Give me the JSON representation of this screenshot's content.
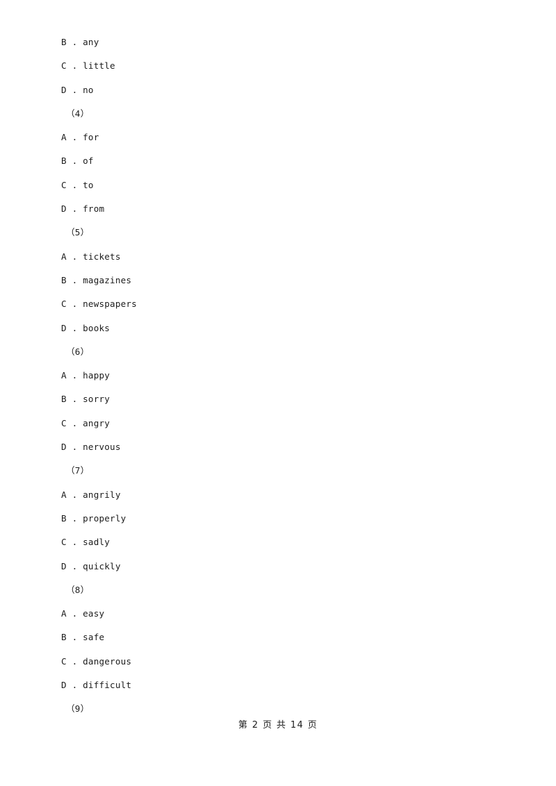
{
  "document": {
    "type": "exam-paper",
    "page_background": "#ffffff",
    "text_color": "#1c1c1c"
  },
  "lines": [
    {
      "kind": "option",
      "text": "B . any"
    },
    {
      "kind": "option",
      "text": "C . little"
    },
    {
      "kind": "option",
      "text": "D . no"
    },
    {
      "kind": "qnum",
      "text": "（4）"
    },
    {
      "kind": "option",
      "text": "A . for"
    },
    {
      "kind": "option",
      "text": "B . of"
    },
    {
      "kind": "option",
      "text": "C . to"
    },
    {
      "kind": "option",
      "text": "D . from"
    },
    {
      "kind": "qnum",
      "text": "（5）"
    },
    {
      "kind": "option",
      "text": "A . tickets"
    },
    {
      "kind": "option",
      "text": "B . magazines"
    },
    {
      "kind": "option",
      "text": "C . newspapers"
    },
    {
      "kind": "option",
      "text": "D . books"
    },
    {
      "kind": "qnum",
      "text": "（6）"
    },
    {
      "kind": "option",
      "text": "A . happy"
    },
    {
      "kind": "option",
      "text": "B . sorry"
    },
    {
      "kind": "option",
      "text": "C . angry"
    },
    {
      "kind": "option",
      "text": "D . nervous"
    },
    {
      "kind": "qnum",
      "text": "（7）"
    },
    {
      "kind": "option",
      "text": "A . angrily"
    },
    {
      "kind": "option",
      "text": "B . properly"
    },
    {
      "kind": "option",
      "text": "C . sadly"
    },
    {
      "kind": "option",
      "text": "D . quickly"
    },
    {
      "kind": "qnum",
      "text": "（8）"
    },
    {
      "kind": "option",
      "text": "A . easy"
    },
    {
      "kind": "option",
      "text": "B . safe"
    },
    {
      "kind": "option",
      "text": "C . dangerous"
    },
    {
      "kind": "option",
      "text": "D . difficult"
    },
    {
      "kind": "qnum",
      "text": "（9）"
    }
  ],
  "footer": {
    "text": "第 2 页 共 14 页",
    "current_page": 2,
    "total_pages": 14
  }
}
